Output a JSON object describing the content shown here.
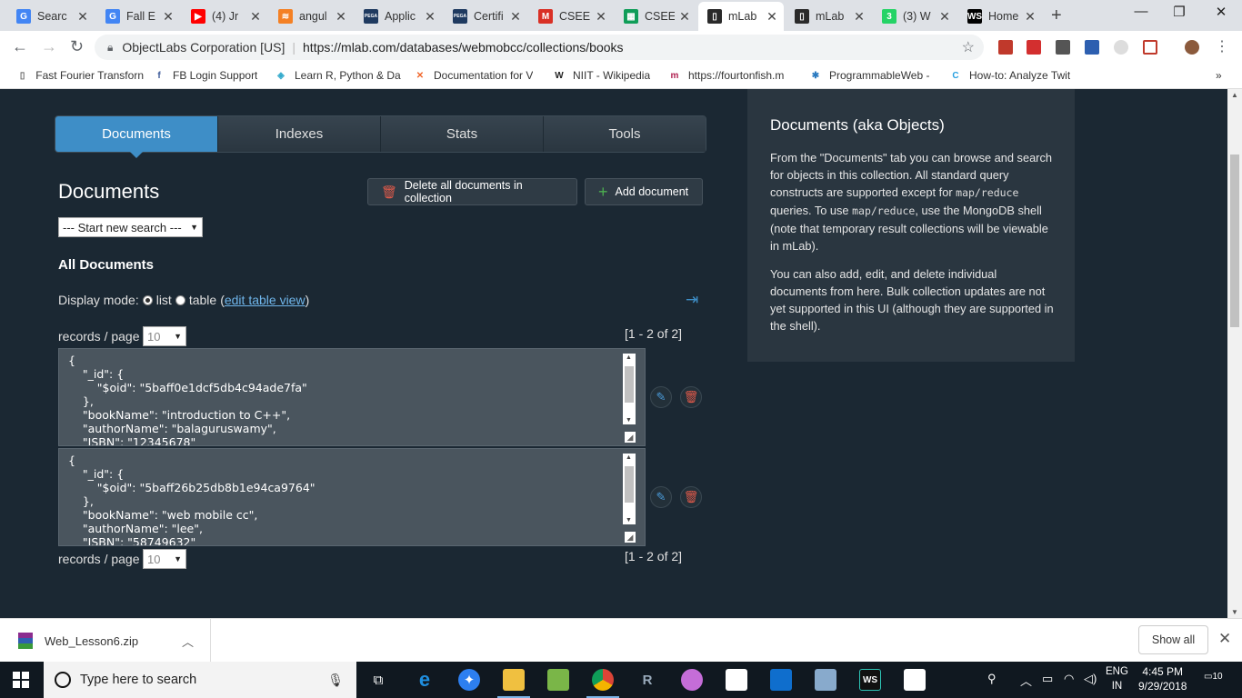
{
  "browser": {
    "tabs": [
      {
        "label": "Searc",
        "favicon": "google-icon",
        "color": "#4285f4",
        "glyph": "G"
      },
      {
        "label": "Fall E",
        "favicon": "google-icon",
        "color": "#4285f4",
        "glyph": "G"
      },
      {
        "label": "(4) Jr",
        "favicon": "youtube-icon",
        "color": "#ff0000",
        "glyph": "▶"
      },
      {
        "label": "angul",
        "favicon": "stackoverflow-icon",
        "color": "#f48024",
        "glyph": "≋"
      },
      {
        "label": "Applic",
        "favicon": "pega-icon",
        "color": "#1f3a60",
        "glyph": "PEGA"
      },
      {
        "label": "Certifi",
        "favicon": "pega-icon",
        "color": "#1f3a60",
        "glyph": "PEGA"
      },
      {
        "label": "CSEE",
        "favicon": "gmail-icon",
        "color": "#d93025",
        "glyph": "M"
      },
      {
        "label": "CSEE",
        "favicon": "sheets-icon",
        "color": "#0f9d58",
        "glyph": "▦"
      },
      {
        "label": "mLab",
        "favicon": "mlab-icon",
        "color": "#2a2a2a",
        "glyph": "▯"
      },
      {
        "label": "mLab",
        "favicon": "mlab-icon",
        "color": "#2a2a2a",
        "glyph": "▯"
      },
      {
        "label": "(3) W",
        "favicon": "whatsapp-icon",
        "color": "#25d366",
        "glyph": "3"
      },
      {
        "label": "Home",
        "favicon": "webstorm-icon",
        "color": "#000000",
        "glyph": "WS"
      }
    ],
    "active_tab_index": 8,
    "new_tab": "+",
    "window_controls": {
      "minimize": "—",
      "restore": "❐",
      "close": "✕"
    },
    "address": {
      "org": "ObjectLabs Corporation [US]",
      "url": "https://mlab.com/databases/webmobcc/collections/books"
    },
    "bookmarks": [
      {
        "label": "Fast Fourier Transforn",
        "icon": "page-icon",
        "color": "#666",
        "glyph": "▯"
      },
      {
        "label": "FB Login Support",
        "icon": "facebook-icon",
        "color": "#3b5998",
        "glyph": "f"
      },
      {
        "label": "Learn R, Python & Da",
        "icon": "datacamp-icon",
        "color": "#33aacc",
        "glyph": "◈"
      },
      {
        "label": "Documentation for V",
        "icon": "vscode-icon",
        "color": "#f0662a",
        "glyph": "✕"
      },
      {
        "label": "NIIT - Wikipedia",
        "icon": "wikipedia-icon",
        "color": "#222",
        "glyph": "W"
      },
      {
        "label": "https://fourtonfish.m",
        "icon": "fourtonfish-icon",
        "color": "#b02050",
        "glyph": "m"
      },
      {
        "label": "ProgrammableWeb -",
        "icon": "programmableweb-icon",
        "color": "#2a7ac0",
        "glyph": "✱"
      },
      {
        "label": "How-to: Analyze Twit",
        "icon": "c-icon",
        "color": "#28a0e0",
        "glyph": "C"
      }
    ],
    "bookmarks_more": "»"
  },
  "mlab": {
    "subtabs": [
      "Documents",
      "Indexes",
      "Stats",
      "Tools"
    ],
    "active_subtab": 0,
    "heading": "Documents",
    "delete_all_label": "Delete all documents in collection",
    "add_document_label": "Add document",
    "search_select": "--- Start new search ---",
    "all_documents": "All Documents",
    "display_mode_label": "Display mode:",
    "mode_list": "list",
    "mode_table": "table",
    "edit_table_view": "edit table view",
    "records_per_page_label": "records / page",
    "records_per_page": "10",
    "range_text": "[1 - 2 of 2]",
    "documents": [
      {
        "json": "{\n    \"_id\": {\n        \"$oid\": \"5baff0e1dcf5db4c94ade7fa\"\n    },\n    \"bookName\": \"introduction to C++\",\n    \"authorName\": \"balaguruswamy\",\n    \"ISBN\": \"12345678\""
      },
      {
        "json": "{\n    \"_id\": {\n        \"$oid\": \"5baff26b25db8b1e94ca9764\"\n    },\n    \"bookName\": \"web mobile cc\",\n    \"authorName\": \"lee\",\n    \"ISBN\": \"58749632\""
      }
    ],
    "sidebar": {
      "title": "Documents (aka Objects)",
      "p1_a": "From the \"Documents\" tab you can browse and search for objects in this collection. All standard query constructs are supported except for ",
      "p1_code1": "map/reduce",
      "p1_b": " queries. To use ",
      "p1_code2": "map/reduce",
      "p1_c": ", use the MongoDB shell (note that temporary result collections will be viewable in mLab).",
      "p2": "You can also add, edit, and delete individual documents from here. Bulk collection updates are not yet supported in this UI (although they are supported in the shell)."
    }
  },
  "downloads": {
    "file": "Web_Lesson6.zip",
    "show_all": "Show all"
  },
  "taskbar": {
    "search_placeholder": "Type here to search",
    "lang_top": "ENG",
    "lang_bottom": "IN",
    "time": "4:45 PM",
    "date": "9/29/2018",
    "notifications": "10"
  }
}
